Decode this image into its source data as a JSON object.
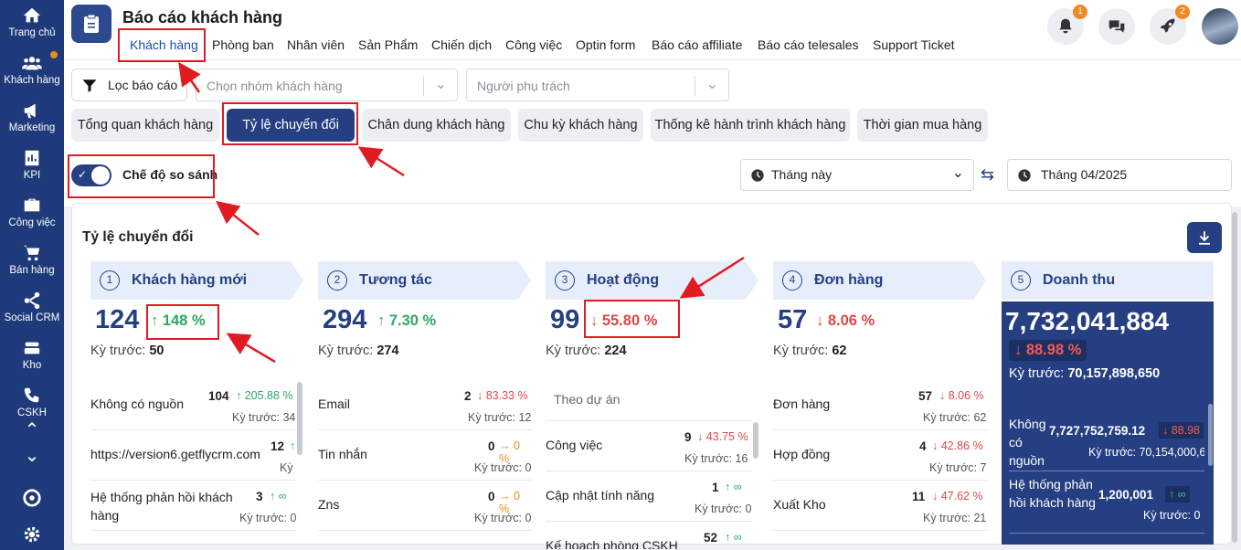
{
  "sidebar": {
    "items": [
      {
        "label": "Trang chủ",
        "icon": "home-icon"
      },
      {
        "label": "Khách hàng",
        "icon": "users-icon"
      },
      {
        "label": "Marketing",
        "icon": "megaphone-icon"
      },
      {
        "label": "KPI",
        "icon": "chart-icon"
      },
      {
        "label": "Công việc",
        "icon": "briefcase-icon"
      },
      {
        "label": "Bán hàng",
        "icon": "cart-icon"
      },
      {
        "label": "Social CRM",
        "icon": "share-icon"
      },
      {
        "label": "Kho",
        "icon": "warehouse-icon"
      },
      {
        "label": "CSKH",
        "icon": "phone-icon"
      }
    ],
    "collapse_up": "⌃",
    "collapse_down": "⌄"
  },
  "header": {
    "title": "Báo cáo khách hàng",
    "nav": [
      "Khách hàng",
      "Phòng ban",
      "Nhân viên",
      "Sản Phẩm",
      "Chiến dịch",
      "Công việc",
      "Optin form",
      "Báo cáo affiliate",
      "Báo cáo telesales",
      "Support Ticket"
    ],
    "notification_count": "1",
    "rocket_count": "2"
  },
  "filters": {
    "filter_button": "Lọc báo cáo",
    "customer_group_placeholder": "Chọn nhóm khách hàng",
    "owner_placeholder": "Người phụ trách"
  },
  "tabs": [
    "Tổng quan khách hàng",
    "Tỷ lệ chuyển đổi",
    "Chân dung khách hàng",
    "Chu kỳ khách hàng",
    "Thống kê hành trình khách hàng",
    "Thời gian mua hàng"
  ],
  "compare": {
    "label": "Chế độ so sánh",
    "enabled": true
  },
  "period": {
    "current": "Tháng này",
    "compare": "Tháng 04/2025"
  },
  "section": {
    "title": "Tỷ lệ chuyển đổi",
    "prev_label": "Kỳ trước:"
  },
  "stages": [
    {
      "num": "1",
      "label": "Khách hàng mới",
      "value": "124",
      "change": "↑ 148 %",
      "trend": "up",
      "prev": "50",
      "rows": [
        {
          "name": "Không có nguồn",
          "value": "104",
          "change": "↑ 205.88 %",
          "trend": "up",
          "prev": "Kỳ trước: 34"
        },
        {
          "name": "https://version6.getflycrm.com",
          "value": "12",
          "change": "↑",
          "trend": "up",
          "prev": "Kỳ t"
        },
        {
          "name": "Hệ thống phản hồi khách hàng",
          "value": "3",
          "change": "↑ ∞",
          "trend": "up",
          "prev": "Kỳ trước: 0"
        }
      ]
    },
    {
      "num": "2",
      "label": "Tương tác",
      "value": "294",
      "change": "↑ 7.30 %",
      "trend": "up",
      "prev": "274",
      "rows": [
        {
          "name": "Email",
          "value": "2",
          "change": "↓ 83.33 %",
          "trend": "down",
          "prev": "Kỳ trước: 12"
        },
        {
          "name": "Tin nhắn",
          "value": "0",
          "change": "→ 0 %",
          "trend": "flat",
          "prev": "Kỳ trước: 0"
        },
        {
          "name": "Zns",
          "value": "0",
          "change": "→ 0 %",
          "trend": "flat",
          "prev": "Kỳ trước: 0"
        }
      ]
    },
    {
      "num": "3",
      "label": "Hoạt động",
      "value": "99",
      "change": "↓ 55.80 %",
      "trend": "down",
      "prev": "224",
      "subheader": "Theo dự án",
      "rows": [
        {
          "name": "Công việc",
          "value": "9",
          "change": "↓ 43.75 %",
          "trend": "down",
          "prev": "Kỳ trước: 16"
        },
        {
          "name": "Cập nhật tính năng",
          "value": "1",
          "change": "↑ ∞",
          "trend": "up",
          "prev": "Kỳ trước: 0"
        },
        {
          "name": "Kế hoạch phòng CSKH",
          "value": "52",
          "change": "↑ ∞",
          "trend": "up",
          "prev": ""
        }
      ]
    },
    {
      "num": "4",
      "label": "Đơn hàng",
      "value": "57",
      "change": "↓ 8.06 %",
      "trend": "down",
      "prev": "62",
      "rows": [
        {
          "name": "Đơn hàng",
          "value": "57",
          "change": "↓ 8.06 %",
          "trend": "down",
          "prev": "Kỳ trước: 62"
        },
        {
          "name": "Hợp đồng",
          "value": "4",
          "change": "↓ 42.86 %",
          "trend": "down",
          "prev": "Kỳ trước: 7"
        },
        {
          "name": "Xuất Kho",
          "value": "11",
          "change": "↓ 47.62 %",
          "trend": "down",
          "prev": "Kỳ trước: 21"
        }
      ]
    },
    {
      "num": "5",
      "label": "Doanh thu",
      "value": "7,732,041,884",
      "change": "↓ 88.98 %",
      "trend": "down",
      "prev": "70,157,898,650",
      "rows": [
        {
          "name": "Không có nguồn",
          "value": "7,727,752,759.12",
          "change": "↓ 88.98",
          "trend": "down",
          "prev": "Kỳ trước: 70,154,000,6"
        },
        {
          "name": "Hệ thống phản hồi khách hàng",
          "value": "1,200,001",
          "change": "↑ ∞",
          "trend": "up",
          "prev": "Kỳ trước: 0"
        }
      ]
    }
  ]
}
